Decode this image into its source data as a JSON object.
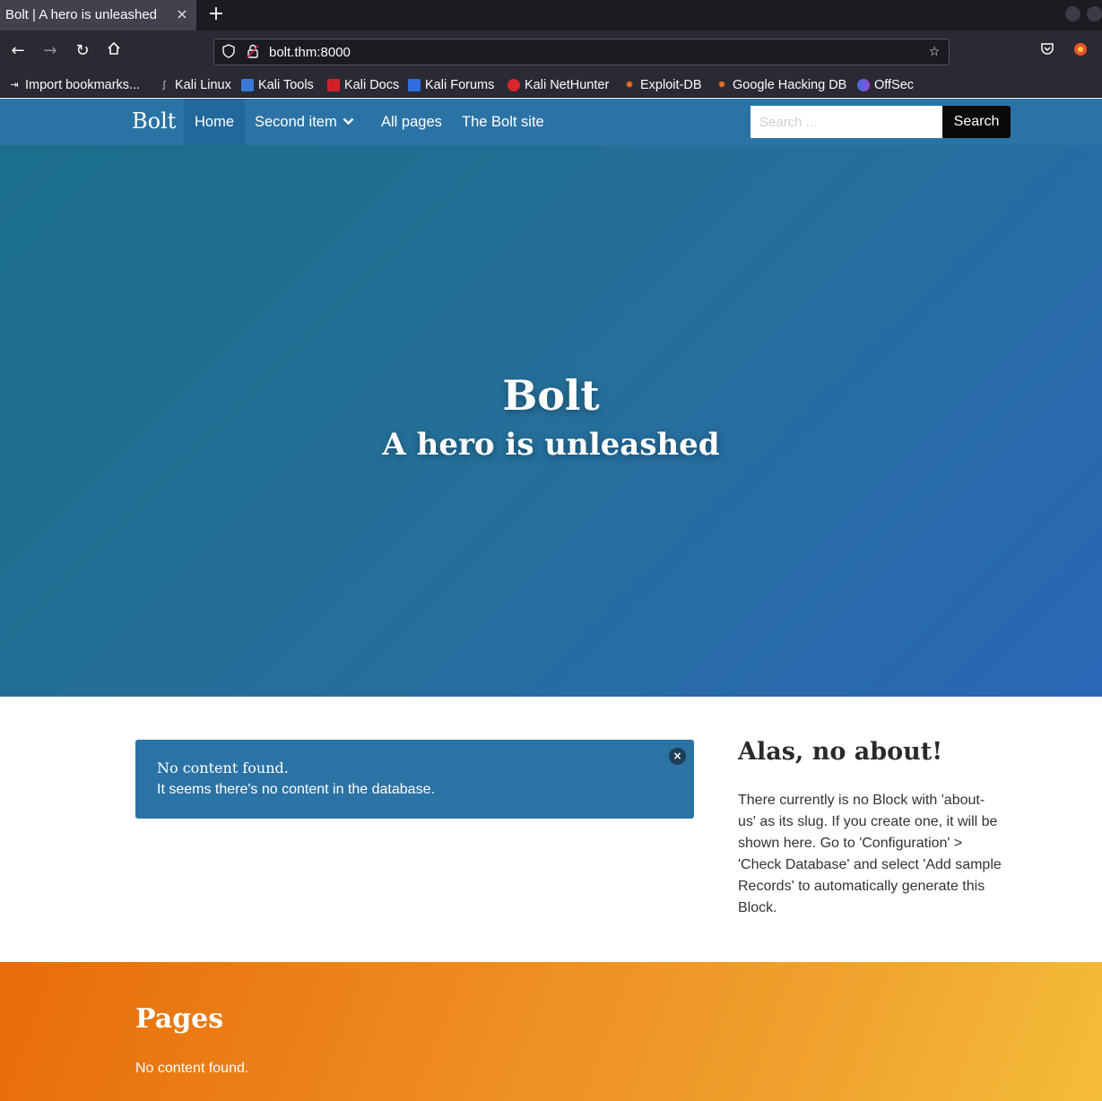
{
  "browser": {
    "tab_title": "Bolt | A hero is unleashed",
    "tab_close": "×",
    "new_tab": "+",
    "url": "bolt.thm:8000",
    "bookmarks": [
      {
        "label": "Import bookmarks...",
        "icon": "import-icon"
      },
      {
        "label": "Kali Linux",
        "icon": "kali-dragon-icon"
      },
      {
        "label": "Kali Tools",
        "icon": "kali-tools-icon"
      },
      {
        "label": "Kali Docs",
        "icon": "kali-docs-icon"
      },
      {
        "label": "Kali Forums",
        "icon": "kali-forums-icon"
      },
      {
        "label": "Kali NetHunter",
        "icon": "nethunter-icon"
      },
      {
        "label": "Exploit-DB",
        "icon": "exploit-db-icon"
      },
      {
        "label": "Google Hacking DB",
        "icon": "ghdb-icon"
      },
      {
        "label": "OffSec",
        "icon": "offsec-icon"
      }
    ]
  },
  "site": {
    "brand": "Bolt",
    "menu": [
      {
        "label": "Home",
        "active": true
      },
      {
        "label": "Second item",
        "has_dropdown": true
      },
      {
        "label": "All pages"
      },
      {
        "label": "The Bolt site"
      }
    ],
    "search": {
      "placeholder": "Search ...",
      "value": "",
      "button": "Search"
    },
    "hero": {
      "title": "Bolt",
      "subtitle": "A hero is unleashed"
    },
    "notice": {
      "title": "No content found.",
      "text": "It seems there's no content in the database.",
      "close": "×"
    },
    "aside": {
      "title": "Alas, no about!",
      "text": "There currently is no Block with 'about-us' as its slug. If you create one, it will be shown here. Go to 'Configuration' > 'Check Database' and select 'Add sample Records' to automatically generate this Block."
    },
    "pages": {
      "title": "Pages",
      "text": "No content found."
    }
  },
  "colors": {
    "navbar": "#2c73a5",
    "hero_start": "#1c6f8c",
    "hero_end": "#2a67b6",
    "pages_start": "#e86c0a",
    "pages_end": "#f4bd3a"
  }
}
